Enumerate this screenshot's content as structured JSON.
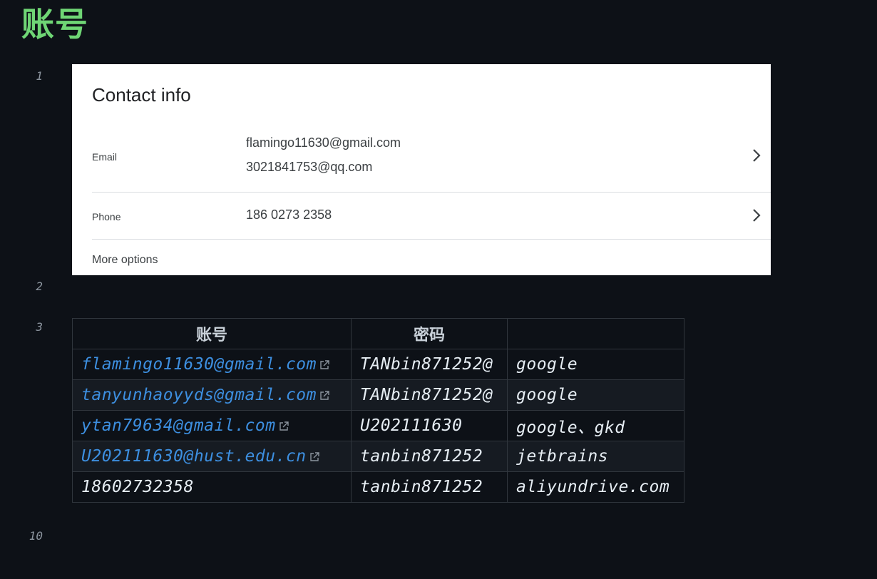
{
  "heading": "账号",
  "line_numbers": {
    "l1": "1",
    "l2": "2",
    "l3": "3",
    "l10": "10"
  },
  "contact_card": {
    "title": "Contact info",
    "email_label": "Email",
    "emails": [
      "flamingo11630@gmail.com",
      "3021841753@qq.com"
    ],
    "phone_label": "Phone",
    "phone": "186 0273 2358",
    "more_options": "More options"
  },
  "table": {
    "headers": [
      "账号",
      "密码",
      ""
    ],
    "rows": [
      {
        "account": "flamingo11630@gmail.com",
        "is_link": true,
        "password": "TANbin871252@",
        "site": "google"
      },
      {
        "account": "tanyunhaoyyds@gmail.com",
        "is_link": true,
        "password": "TANbin871252@",
        "site": "google"
      },
      {
        "account": "ytan79634@gmail.com",
        "is_link": true,
        "password": "U202111630",
        "site": "google、gkd"
      },
      {
        "account": "U202111630@hust.edu.cn",
        "is_link": true,
        "password": "tanbin871252",
        "site": "jetbrains"
      },
      {
        "account": "18602732358",
        "is_link": false,
        "password": "tanbin871252",
        "site": "aliyundrive.com"
      }
    ]
  },
  "colors": {
    "background": "#0d1117",
    "heading": "#6fd675",
    "link": "#3d8fe0"
  },
  "icons": [
    "external-link-icon",
    "chevron-right-icon"
  ]
}
